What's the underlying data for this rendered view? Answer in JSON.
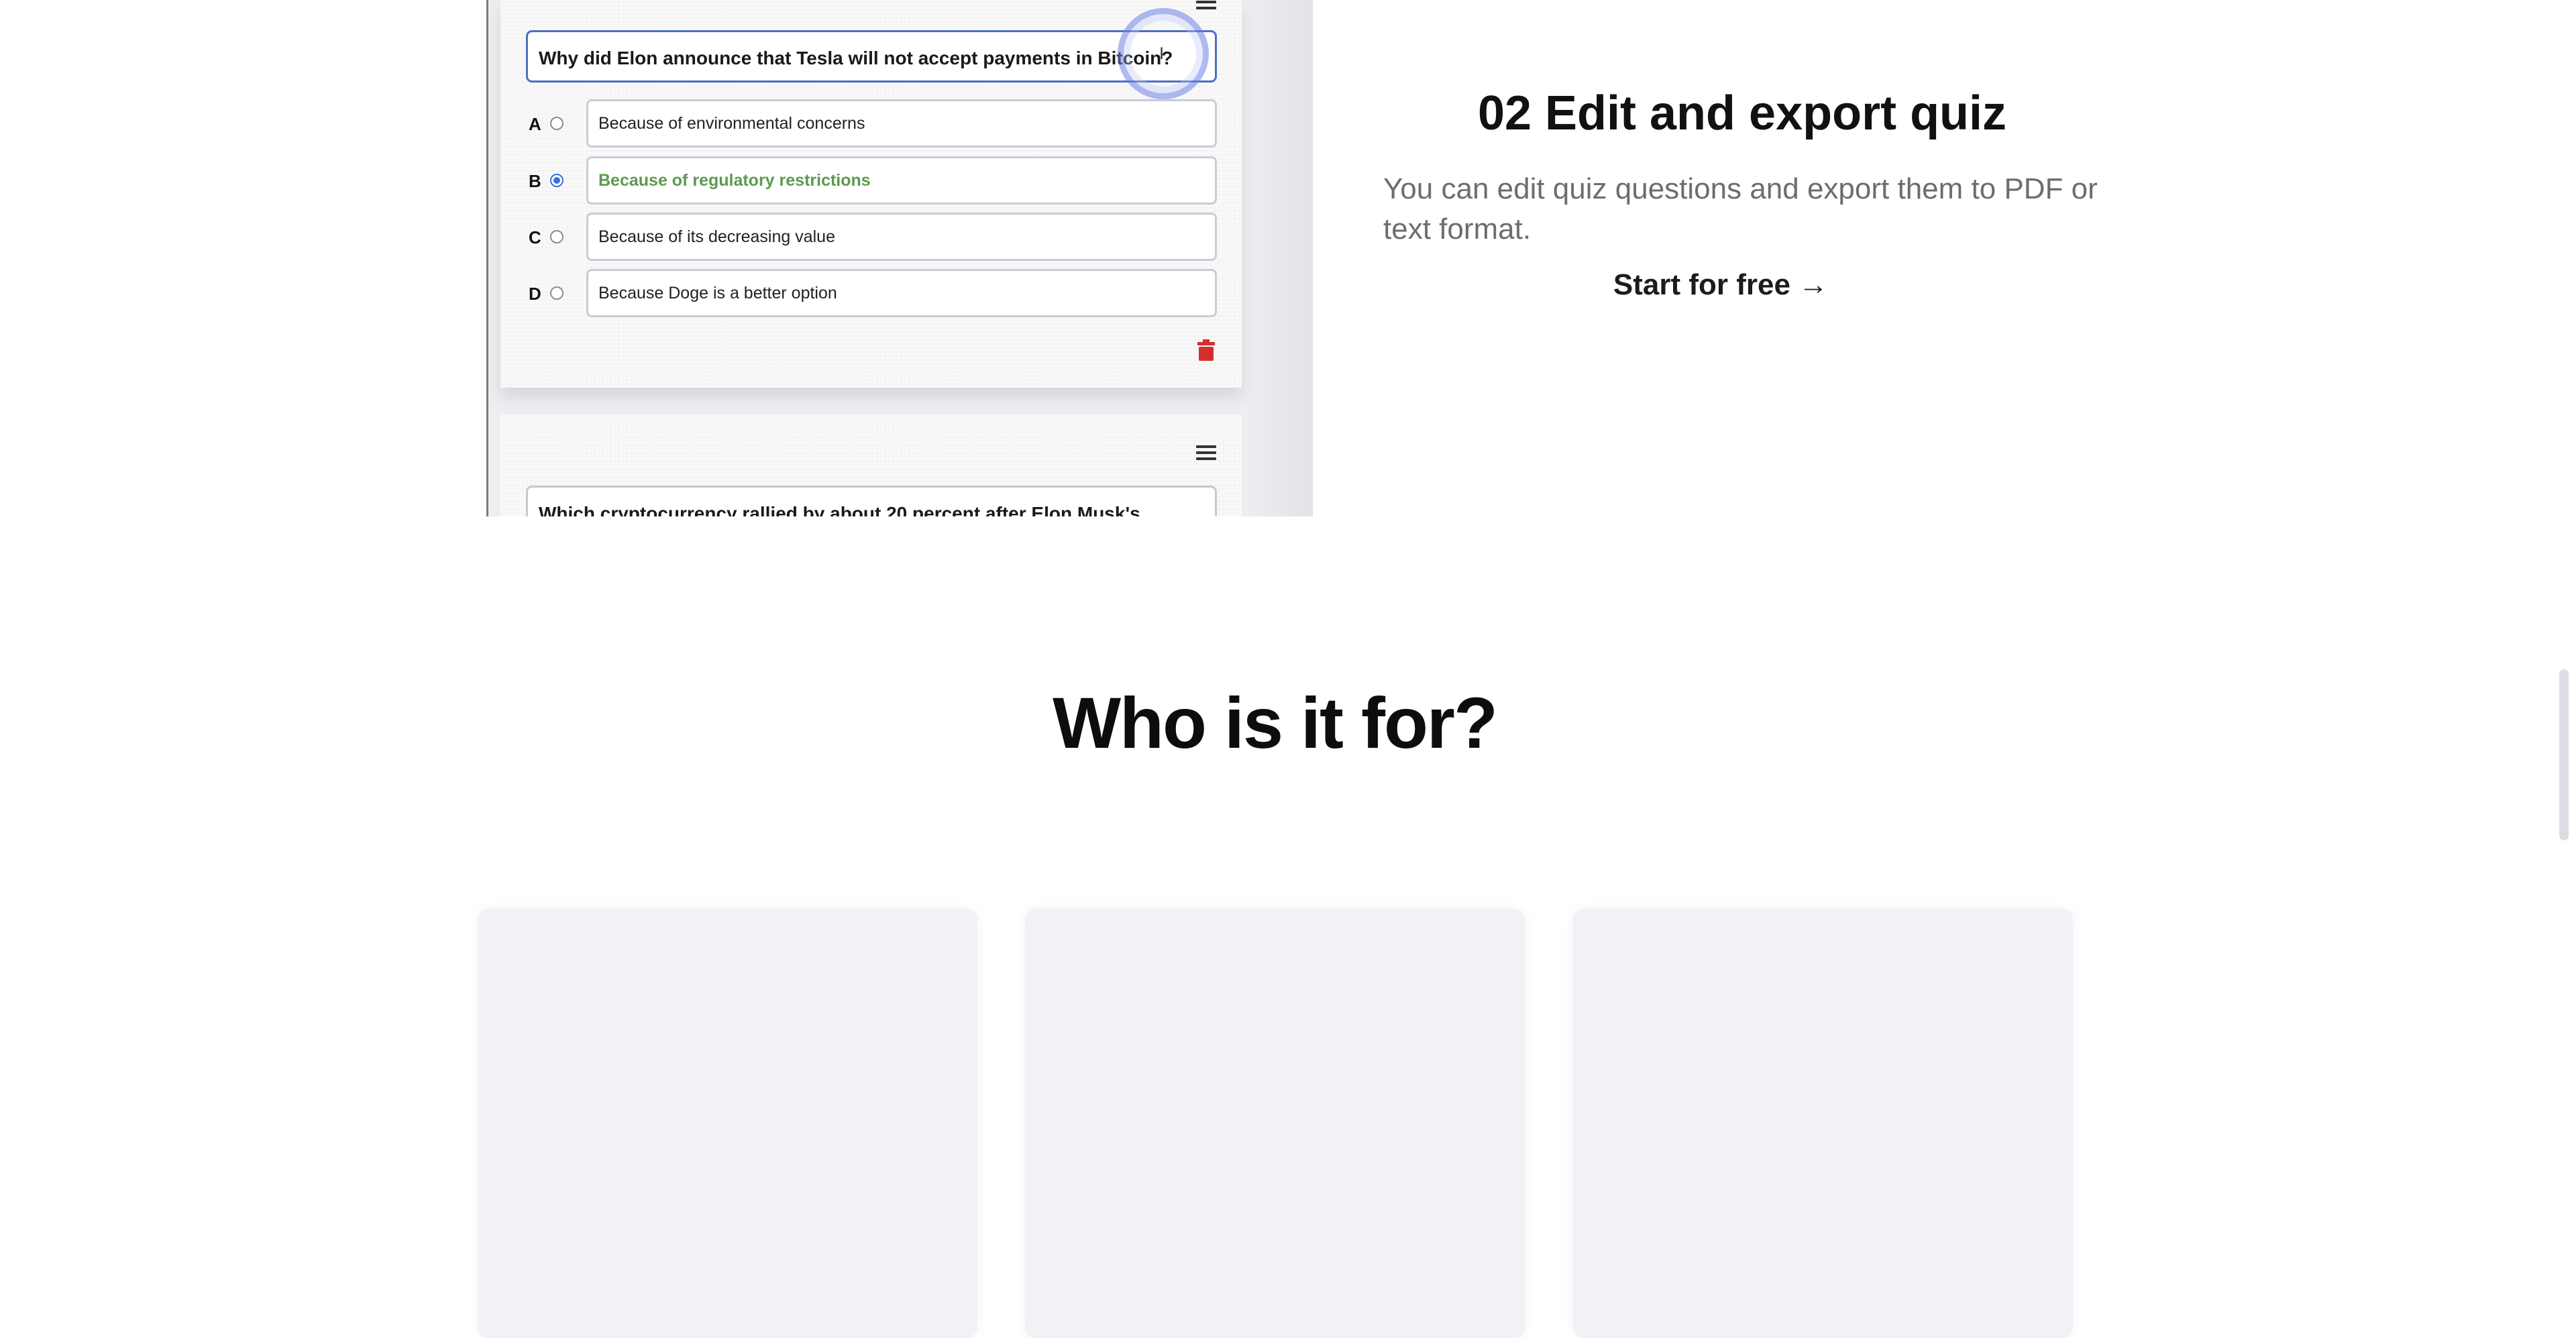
{
  "quiz_preview": {
    "question_1": {
      "text": "Why did Elon announce that Tesla will not accept payments in Bitcoin?",
      "answers": [
        {
          "letter": "A",
          "text": "Because of environmental concerns",
          "selected": false
        },
        {
          "letter": "B",
          "text": "Because of regulatory restrictions",
          "selected": true
        },
        {
          "letter": "C",
          "text": "Because of its decreasing value",
          "selected": false
        },
        {
          "letter": "D",
          "text": "Because Doge is a better option",
          "selected": false
        }
      ],
      "icons": {
        "menu": "menu-icon",
        "delete": "trash-icon"
      },
      "correct_answer_color": "#5c9a4e",
      "delete_icon_color": "#d32f2f"
    },
    "question_2": {
      "text": "Which cryptocurrency rallied by about 20 percent after Elon Musk's"
    }
  },
  "feature": {
    "title": "02 Edit and export quiz",
    "description": "You can edit quiz questions and export them to PDF or text format.",
    "cta": "Start for free →"
  },
  "audience": {
    "title": "Who is it for?",
    "cards": [
      "",
      "",
      ""
    ]
  },
  "colors": {
    "accent_focus": "#4b6fc2",
    "card_background": "#f1f2f6",
    "muted_text": "#6d6d6d"
  }
}
